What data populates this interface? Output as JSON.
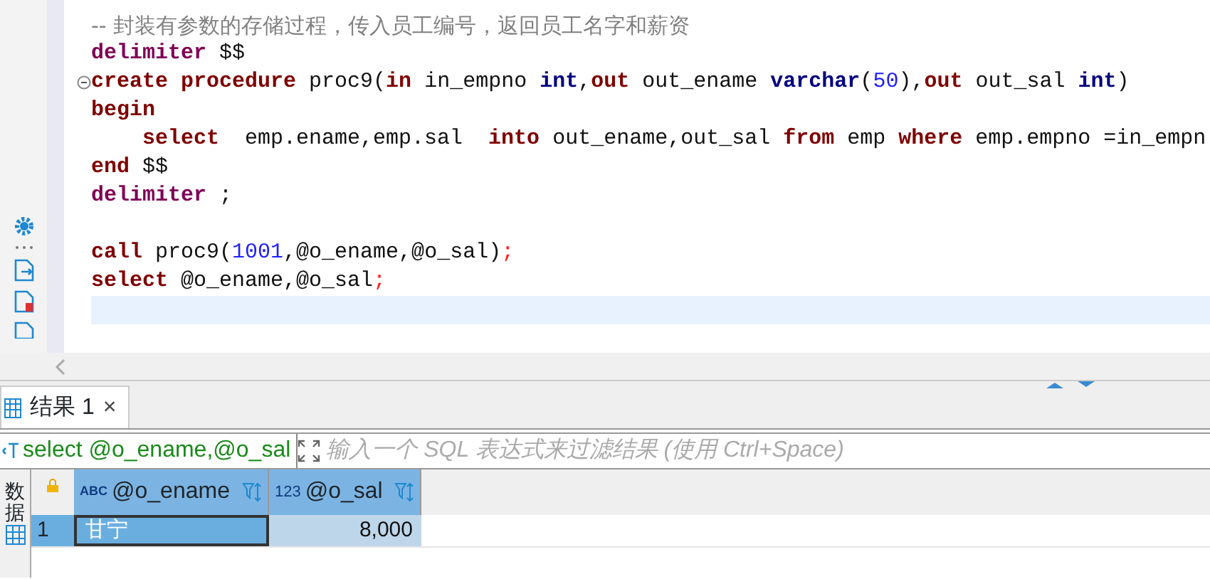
{
  "editor": {
    "lines": [
      {
        "tokens": [
          {
            "kind": "comment",
            "text": "-- 封装有参数的存储过程，传入员工编号，返回员工名字和薪资"
          }
        ]
      },
      {
        "tokens": [
          {
            "kind": "directive",
            "text": "delimiter"
          },
          {
            "kind": "plain",
            "text": " $$"
          }
        ]
      },
      {
        "foldable": true,
        "tokens": [
          {
            "kind": "keyword",
            "text": "create"
          },
          {
            "kind": "keyword",
            "text": " procedure"
          },
          {
            "kind": "plain",
            "text": " proc9("
          },
          {
            "kind": "keyword",
            "text": "in"
          },
          {
            "kind": "plain",
            "text": " in_empno "
          },
          {
            "kind": "type",
            "text": "int"
          },
          {
            "kind": "plain",
            "text": ","
          },
          {
            "kind": "keyword",
            "text": "out"
          },
          {
            "kind": "plain",
            "text": " out_ename "
          },
          {
            "kind": "type",
            "text": "varchar"
          },
          {
            "kind": "plain",
            "text": "("
          },
          {
            "kind": "number",
            "text": "50"
          },
          {
            "kind": "plain",
            "text": "),"
          },
          {
            "kind": "keyword",
            "text": "out"
          },
          {
            "kind": "plain",
            "text": " out_sal "
          },
          {
            "kind": "type",
            "text": "int"
          },
          {
            "kind": "plain",
            "text": ")"
          }
        ]
      },
      {
        "tokens": [
          {
            "kind": "keyword",
            "text": "begin"
          }
        ]
      },
      {
        "tokens": [
          {
            "kind": "keyword",
            "text": "    select"
          },
          {
            "kind": "plain",
            "text": "  emp.ename,emp.sal  "
          },
          {
            "kind": "keyword",
            "text": "into"
          },
          {
            "kind": "plain",
            "text": " out_ename,out_sal "
          },
          {
            "kind": "keyword",
            "text": "from"
          },
          {
            "kind": "plain",
            "text": " emp "
          },
          {
            "kind": "keyword",
            "text": "where"
          },
          {
            "kind": "plain",
            "text": " emp.empno =in_empn"
          }
        ]
      },
      {
        "tokens": [
          {
            "kind": "keyword",
            "text": "end"
          },
          {
            "kind": "plain",
            "text": " $$"
          }
        ]
      },
      {
        "tokens": [
          {
            "kind": "directive",
            "text": "delimiter"
          },
          {
            "kind": "plain",
            "text": " ;"
          }
        ]
      },
      {
        "kind": "blank"
      },
      {
        "tokens": [
          {
            "kind": "keyword",
            "text": "call"
          },
          {
            "kind": "plain",
            "text": " proc9("
          },
          {
            "kind": "number",
            "text": "1001"
          },
          {
            "kind": "plain",
            "text": ",@o_ename,@o_sal)"
          },
          {
            "kind": "semicolon",
            "text": ";"
          }
        ]
      },
      {
        "tokens": [
          {
            "kind": "keyword",
            "text": "select"
          },
          {
            "kind": "plain",
            "text": " @o_ename,@o_sal"
          },
          {
            "kind": "semicolon",
            "text": ";"
          }
        ]
      },
      {
        "kind": "blank",
        "current": true
      }
    ]
  },
  "results": {
    "tabs": [
      {
        "label": "结果 1",
        "close": "×",
        "selected": true
      }
    ],
    "filter": {
      "query": "select @o_ename,@o_sal",
      "placeholder": "输入一个 SQL 表达式来过滤结果 (使用 Ctrl+Space)"
    },
    "side_label": "数据",
    "columns": [
      {
        "type": "ABC",
        "kind": "text",
        "name": "@o_ename"
      },
      {
        "type": "123",
        "kind": "number",
        "name": "@o_sal"
      }
    ],
    "rows": [
      {
        "number": "1",
        "cells": [
          {
            "text": "甘宁",
            "focused": true
          },
          {
            "text": "8,000",
            "focused": false
          }
        ]
      }
    ]
  }
}
